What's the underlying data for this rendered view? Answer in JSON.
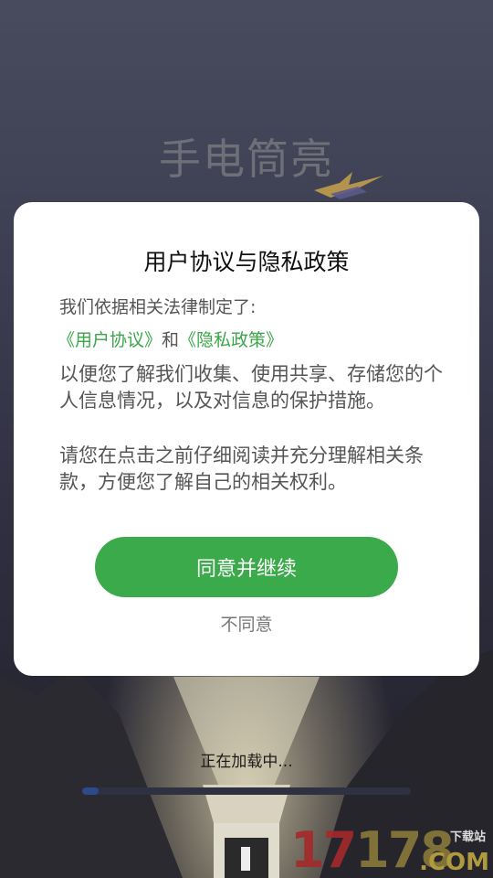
{
  "background": {
    "app_name": "手电筒亮",
    "loading_text": "正在加载中...",
    "progress_percent": 5,
    "watermark": {
      "number": "17178",
      "site": "下载站",
      "domain": ".COM"
    }
  },
  "dialog": {
    "title": "用户协议与隐私政策",
    "intro": "我们依据相关法律制定了:",
    "link_user_agreement": "《用户协议》",
    "link_and": "和",
    "link_privacy_policy": "《隐私政策》",
    "paragraph1": "以便您了解我们收集、使用共享、存储您的个人信息情况，以及对信息的保护措施。",
    "paragraph2": "请您在点击之前仔细阅读并充分理解相关条款，方便您了解自己的相关权利。",
    "agree_label": "同意并继续",
    "disagree_label": "不同意"
  },
  "colors": {
    "accent_green": "#3aaa4a",
    "link_green": "#3aa648",
    "progress_fill": "#2d4a8a"
  }
}
